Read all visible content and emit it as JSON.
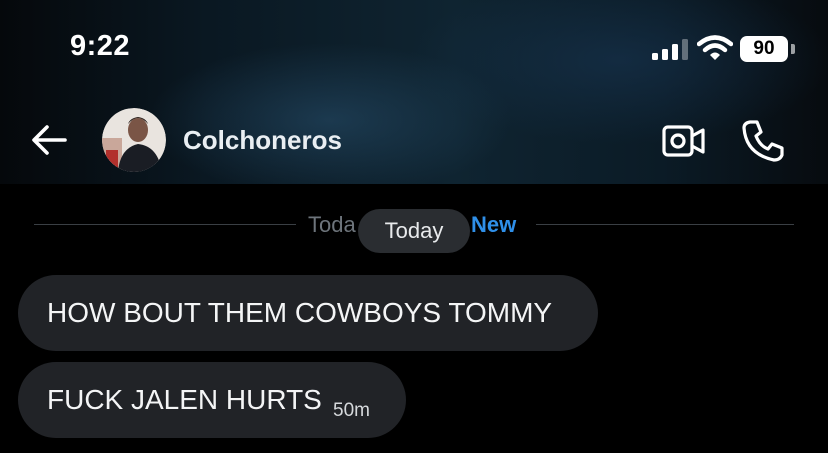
{
  "status_bar": {
    "time": "9:22",
    "battery": "90",
    "icons": [
      "signal-icon",
      "wifi-icon",
      "battery-icon"
    ]
  },
  "header": {
    "title": "Colchoneros",
    "icons": [
      "back-arrow-icon",
      "avatar",
      "video-camera-icon",
      "phone-icon"
    ]
  },
  "divider": {
    "date_obscured": "Toda",
    "date_pill": "Today",
    "new_label": "New"
  },
  "messages": [
    {
      "text": "HOW BOUT THEM COWBOYS TOMMY"
    },
    {
      "text": "FUCK JALEN HURTS",
      "time": "50m"
    }
  ],
  "colors": {
    "background": "#000000",
    "bubble": "#212327",
    "new_accent": "#2f8fe8",
    "pill": "#2a2d31"
  }
}
